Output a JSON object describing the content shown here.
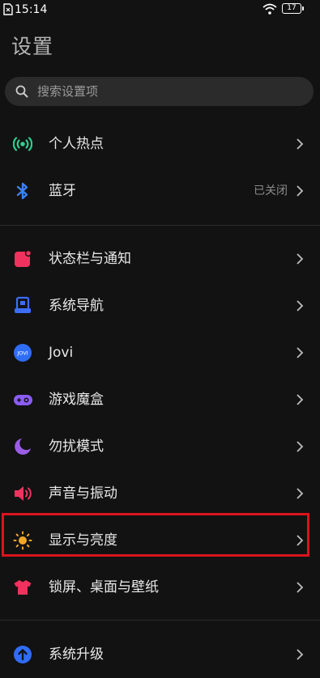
{
  "status_bar": {
    "time": "15:14",
    "battery": "17"
  },
  "title": "设置",
  "search": {
    "placeholder": "搜索设置项"
  },
  "section1": [
    {
      "label": "个人热点",
      "icon": "hotspot-icon",
      "color": "#2fcf8f"
    },
    {
      "label": "蓝牙",
      "value": "已关闭",
      "icon": "bluetooth-icon",
      "color": "#3b82f6"
    }
  ],
  "section2": [
    {
      "label": "状态栏与通知",
      "icon": "notification-icon",
      "color": "#f0325e"
    },
    {
      "label": "系统导航",
      "icon": "navigation-icon",
      "color": "#3b6ef5"
    },
    {
      "label": "Jovi",
      "icon": "jovi-icon",
      "color": "#2f6df6"
    },
    {
      "label": "游戏魔盒",
      "icon": "gamepad-icon",
      "color": "#8b5cf6"
    },
    {
      "label": "勿扰模式",
      "icon": "moon-icon",
      "color": "#9b5de5"
    },
    {
      "label": "声音与振动",
      "icon": "speaker-icon",
      "color": "#f0325e"
    },
    {
      "label": "显示与亮度",
      "icon": "sun-icon",
      "color": "#f5a623",
      "highlighted": true
    },
    {
      "label": "锁屏、桌面与壁纸",
      "icon": "shirt-icon",
      "color": "#f0325e"
    }
  ],
  "section3": [
    {
      "label": "系统升级",
      "icon": "upgrade-icon",
      "color": "#2f6df6"
    }
  ]
}
